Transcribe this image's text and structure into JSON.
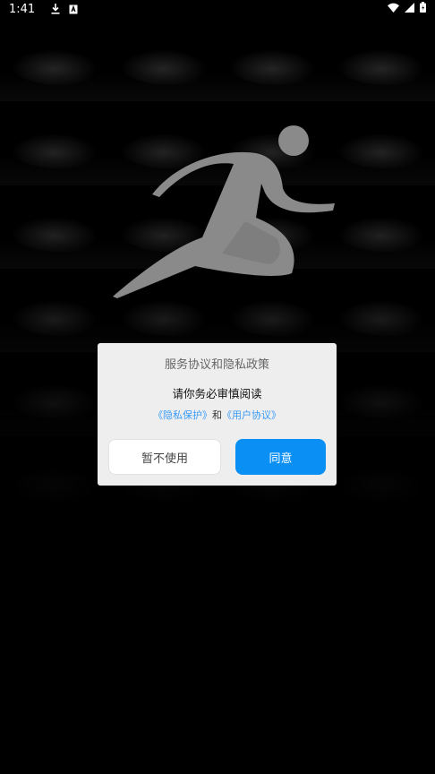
{
  "status_bar": {
    "time": "1:41",
    "left_icons": [
      "download-icon",
      "notification-a-icon"
    ],
    "right_icons": [
      "wifi-icon",
      "signal-icon",
      "battery-icon"
    ]
  },
  "background": {
    "type": "photo-mosaic",
    "tiles": 24
  },
  "logo": {
    "icon": "running-person-icon",
    "color": "#8a8a8a"
  },
  "dialog": {
    "title": "服务协议和隐私政策",
    "subtitle": "请你务必审慎阅读",
    "privacy_link": "《隐私保护》",
    "conjunction": "和",
    "agreement_link": "《用户协议》",
    "decline_label": "暂不使用",
    "agree_label": "同意",
    "accent_color": "#0a8ff5",
    "link_color": "#3a9bf5"
  }
}
